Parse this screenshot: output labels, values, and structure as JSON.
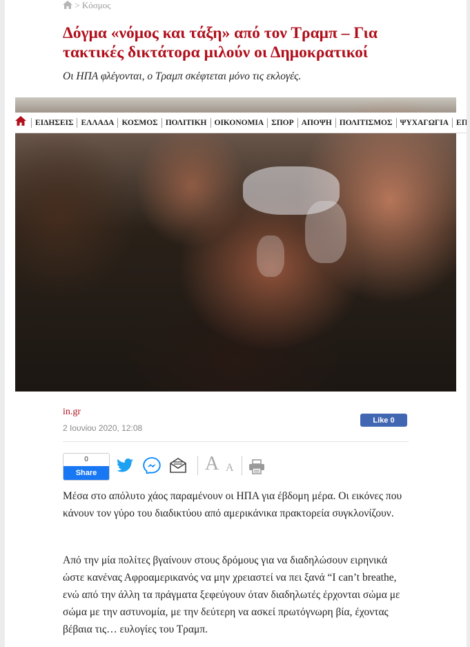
{
  "breadcrumb": {
    "home_icon": "home-icon",
    "separator": ">",
    "section": "Κόσμος"
  },
  "article": {
    "title": "Δόγμα «νόμος και τάξη» από τον Τραμπ – Για τακτικές δικτάτορα μιλούν οι Δημοκρατικοί",
    "subtitle": "Οι ΗΠΑ φλέγονται, ο Τραμπ σκέφτεται μόνο τις εκλογές.",
    "source": "in.gr",
    "date": "2 Ιουνίου 2020, 12:08",
    "paragraphs": [
      "Μέσα στο απόλυτο χάος παραμένουν οι ΗΠΑ για έβδομη μέρα. Οι εικόνες που κάνουν τον γύρο του διαδικτύου από αμερικάνικα πρακτορεία συγκλονίζουν.",
      "Από την μία πολίτες βγαίνουν στους δρόμους για να διαδηλώσουν ειρηνικά ώστε κανένας Αφροαμερικανός να μην χρειαστεί να πει ξανά “I can’t breathe, ενώ από την άλλη τα πράγματα ξεφεύγουν όταν διαδηλωτές έρχονται σώμα με σώμα με την αστυνομία, με την δεύτερη να ασκεί πρωτόγνωρη βία, έχοντας βέβαια τις… ευλογίες του Τραμπ."
    ]
  },
  "nav": {
    "home_icon": "home-icon",
    "items": [
      "ΕΙΔΗΣΕΙΣ",
      "ΕΛΛΑΔΑ",
      "ΚΟΣΜΟΣ",
      "ΠΟΛΙΤΙΚΗ",
      "ΟΙΚΟΝΟΜΙΑ",
      "ΣΠΟΡ",
      "ΑΠΟΨΗ",
      "ΠΟΛΙΤΙΣΜΟΣ",
      "ΨΥΧΑΓΩΓΙΑ",
      "ΕΠ"
    ]
  },
  "social": {
    "like_label": "Like 0",
    "share_count": "0",
    "share_label": "Share",
    "font_large": "A",
    "font_small": "A"
  },
  "colors": {
    "brand_red": "#b00f1b",
    "facebook_blue": "#1877f2",
    "like_blue": "#4267b2",
    "twitter_blue": "#1da1f2",
    "messenger_blue": "#0084ff"
  }
}
